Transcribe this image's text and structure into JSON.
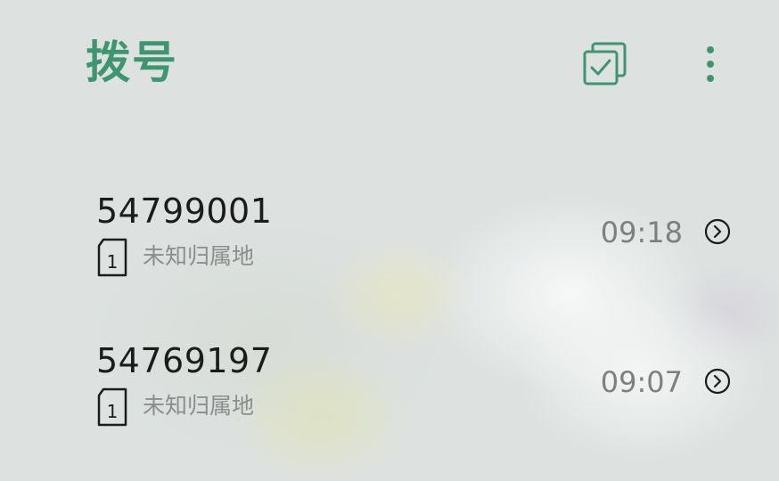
{
  "header": {
    "title": "拨号",
    "select_icon": "multi-select-checkbox-icon",
    "more_icon": "more-vertical-icon"
  },
  "calls": [
    {
      "number": "54799001",
      "sim": "1",
      "location": "未知归属地",
      "time": "09:18"
    },
    {
      "number": "54769197",
      "sim": "1",
      "location": "未知归属地",
      "time": "09:07"
    }
  ],
  "colors": {
    "accent": "#3f9570",
    "number_text": "#1b1d1c",
    "secondary_text": "#8a8e8c"
  }
}
